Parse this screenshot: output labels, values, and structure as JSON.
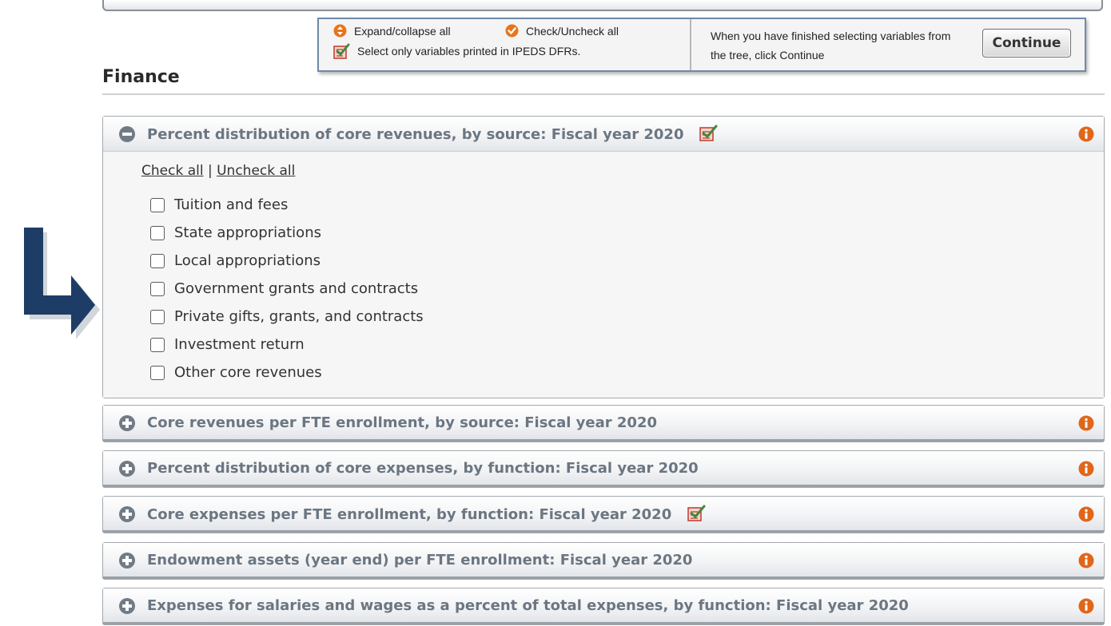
{
  "legend": {
    "expand_label": "Expand/collapse all",
    "check_label": "Check/Uncheck all",
    "dfr_label": "Select only variables printed in IPEDS DFRs.",
    "instructions": "When you have finished selecting variables from the tree, click Continue",
    "continue_label": "Continue"
  },
  "section": {
    "title": "Finance"
  },
  "panels": [
    {
      "title": "Percent distribution of core revenues, by source: Fiscal year 2020",
      "expanded": true,
      "dfr": true,
      "check_all": "Check all",
      "separator": "|",
      "uncheck_all": "Uncheck all",
      "items": [
        "Tuition and fees",
        "State appropriations",
        "Local appropriations",
        "Government grants and contracts",
        "Private gifts, grants, and contracts",
        "Investment return",
        "Other core revenues"
      ]
    },
    {
      "title": "Core revenues per FTE enrollment, by source: Fiscal year 2020",
      "expanded": false,
      "dfr": false
    },
    {
      "title": "Percent distribution of core expenses, by function: Fiscal year 2020",
      "expanded": false,
      "dfr": false
    },
    {
      "title": "Core expenses per FTE enrollment, by function: Fiscal year 2020",
      "expanded": false,
      "dfr": true
    },
    {
      "title": "Endowment assets (year end) per FTE enrollment: Fiscal year 2020",
      "expanded": false,
      "dfr": false
    },
    {
      "title": "Expenses for salaries and wages as a percent of total expenses, by function: Fiscal year 2020",
      "expanded": false,
      "dfr": false
    }
  ],
  "colors": {
    "accent_orange": "#e8741c",
    "title_gray": "#6b7681",
    "navy_arrow": "#1d3d66",
    "dfr_green": "#3c8a3c",
    "dfr_red": "#c0392b"
  },
  "icons": {
    "expand": "plus-circle-icon",
    "collapse": "minus-circle-icon",
    "info": "info-icon",
    "check": "orange-check-icon",
    "dfr": "dfr-checklist-icon",
    "pointer": "bent-arrow-icon"
  }
}
